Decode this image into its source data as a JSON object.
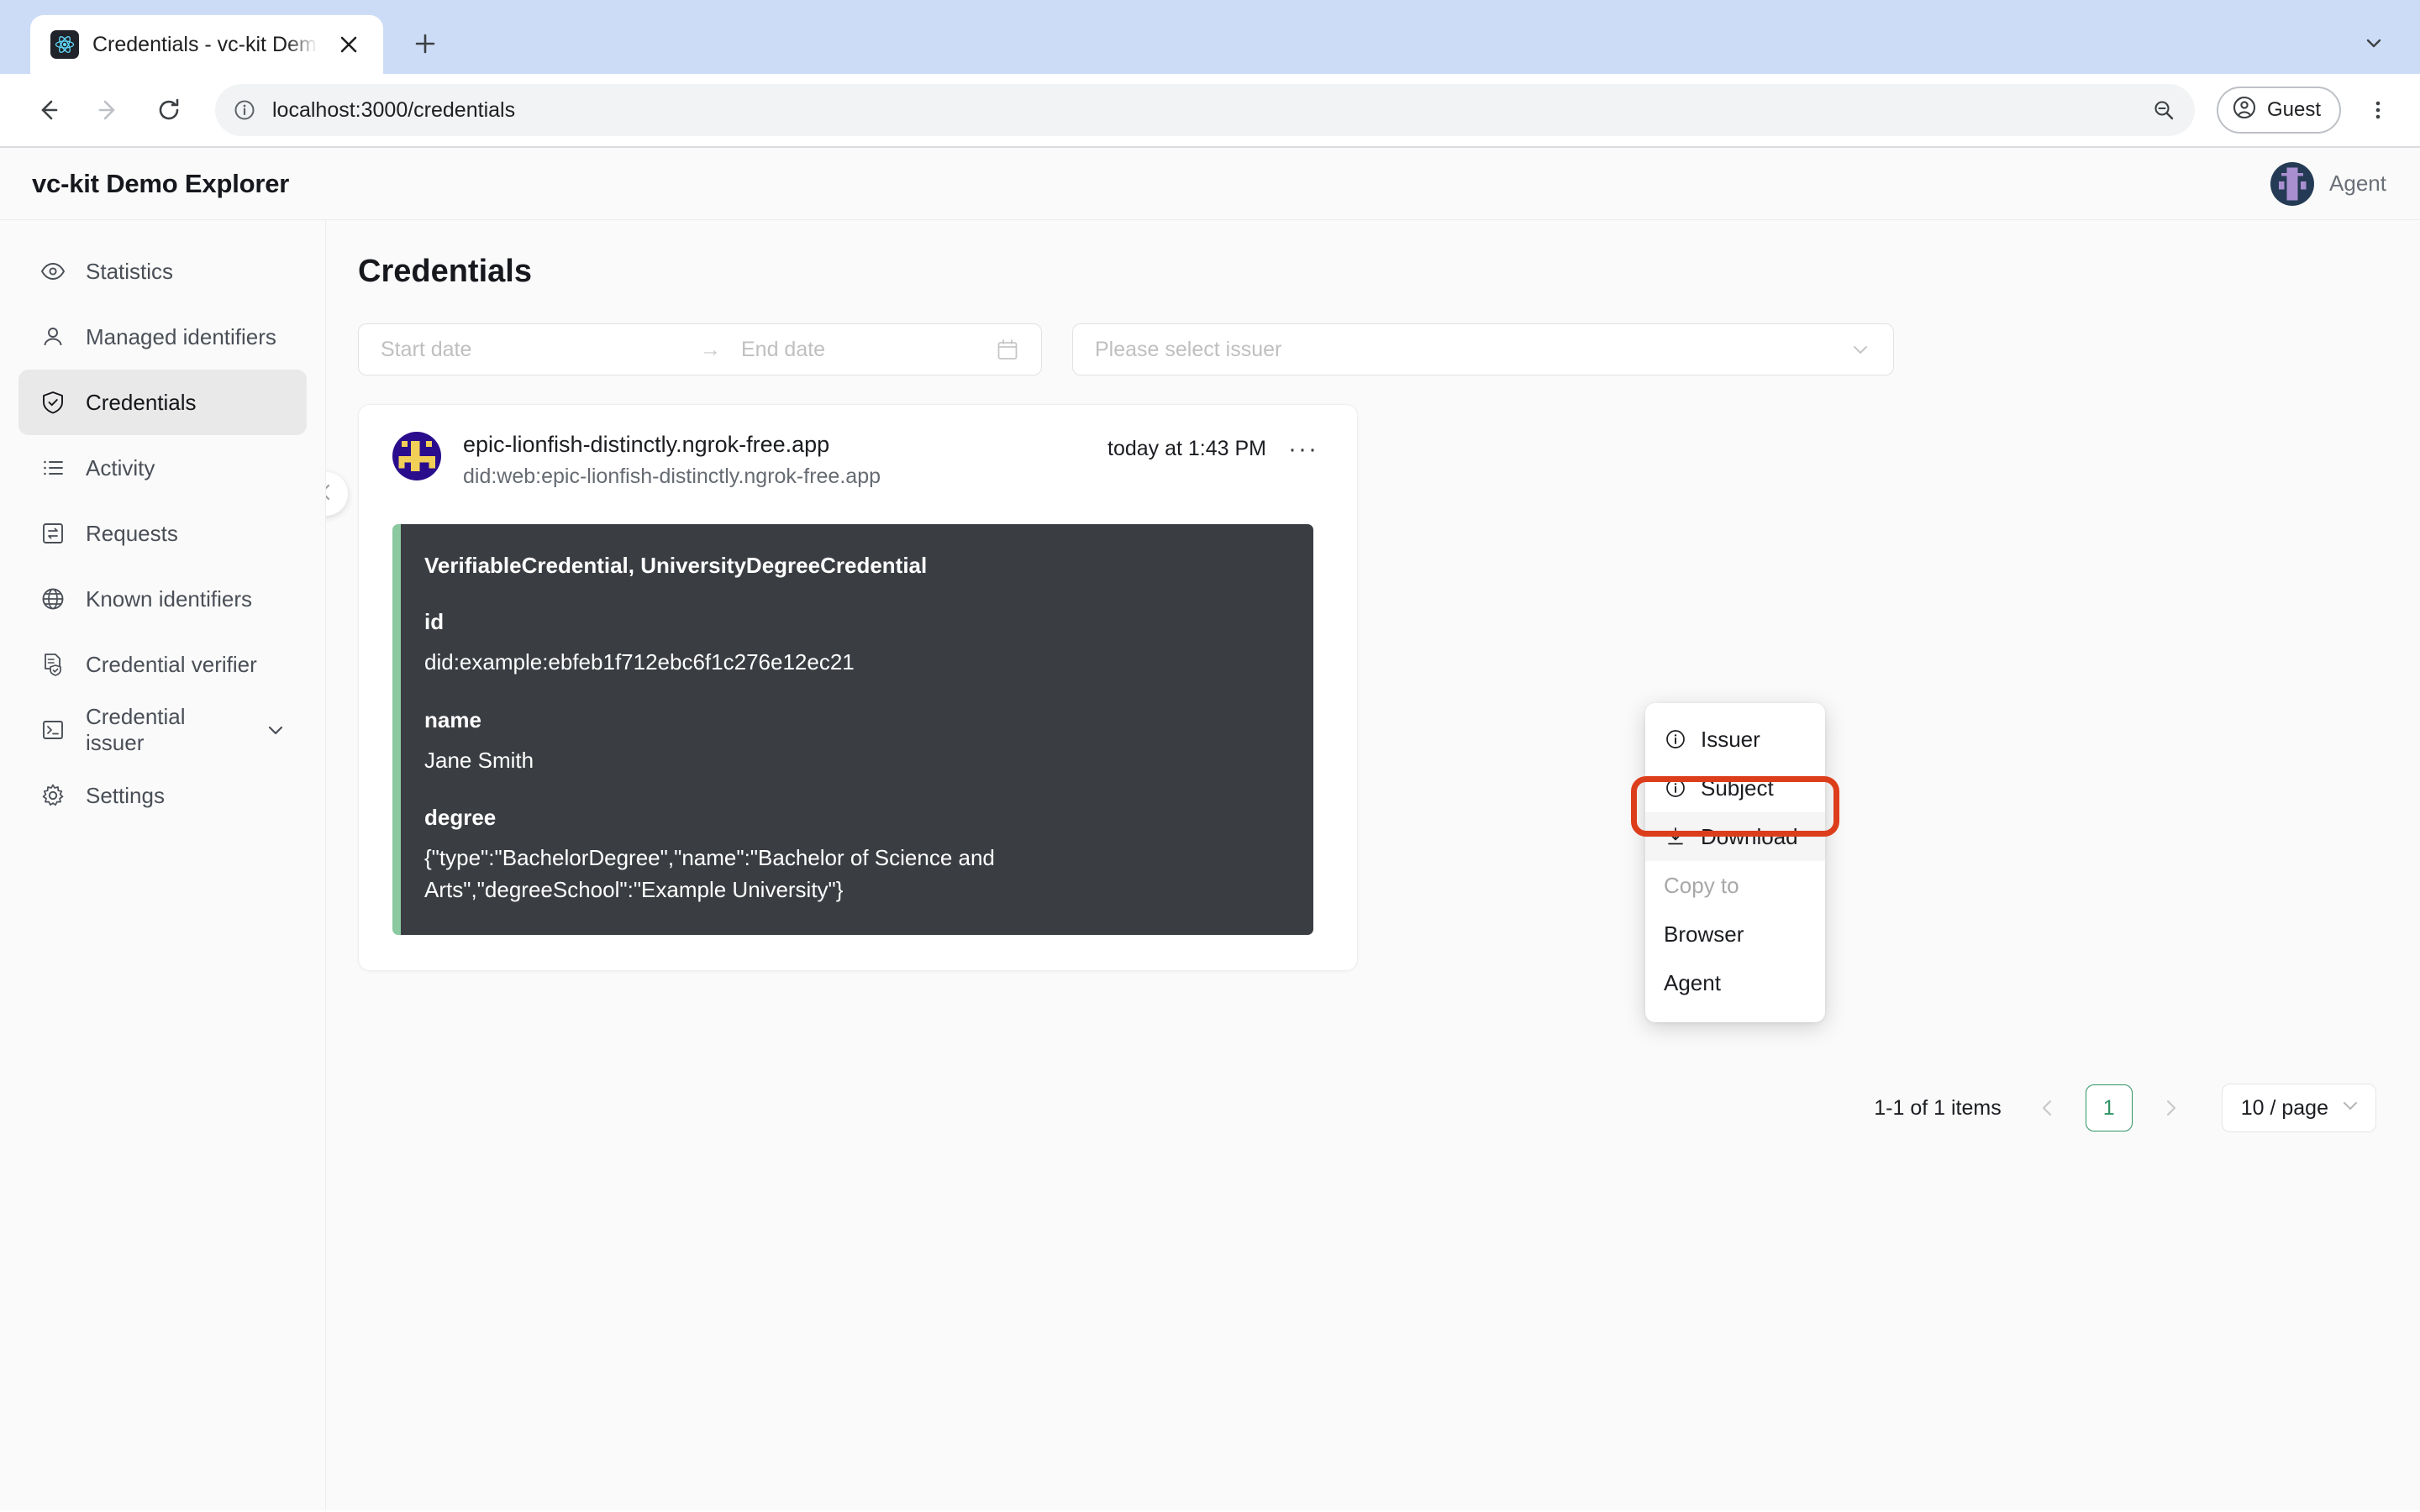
{
  "browser": {
    "tab": {
      "title": "Credentials - vc-kit Demo Ex",
      "favicon": "react-icon",
      "close": "close-icon"
    },
    "new_tab_label": "new-tab-icon",
    "back": "back-arrow-icon",
    "forward": "forward-arrow-icon",
    "reload": "reload-icon",
    "site_info": "info-icon",
    "url": "localhost:3000/credentials",
    "zoom_icon": "zoom-out-icon",
    "profile_label": "Guest",
    "menu_icon": "vertical-dots-icon"
  },
  "app": {
    "title": "vc-kit Demo Explorer",
    "user": {
      "name": "Agent",
      "avatar": "robot-avatar"
    }
  },
  "sidebar": {
    "items": [
      {
        "label": "Statistics",
        "icon": "eye-icon",
        "active": false,
        "expandable": false
      },
      {
        "label": "Managed identifiers",
        "icon": "user-icon",
        "active": false,
        "expandable": false
      },
      {
        "label": "Credentials",
        "icon": "shield-check-icon",
        "active": true,
        "expandable": false
      },
      {
        "label": "Activity",
        "icon": "list-icon",
        "active": false,
        "expandable": false
      },
      {
        "label": "Requests",
        "icon": "exchange-icon",
        "active": false,
        "expandable": false
      },
      {
        "label": "Known identifiers",
        "icon": "globe-icon",
        "active": false,
        "expandable": false
      },
      {
        "label": "Credential verifier",
        "icon": "document-shield-icon",
        "active": false,
        "expandable": false
      },
      {
        "label": "Credential issuer",
        "icon": "terminal-icon",
        "active": false,
        "expandable": true
      },
      {
        "label": "Settings",
        "icon": "gear-icon",
        "active": false,
        "expandable": false
      }
    ]
  },
  "page": {
    "heading": "Credentials",
    "collapse_icon": "chevron-left-icon"
  },
  "filters": {
    "start_date_placeholder": "Start date",
    "range_separator": "→",
    "end_date_placeholder": "End date",
    "calendar_icon": "calendar-icon",
    "issuer_placeholder": "Please select issuer",
    "issuer_chevron": "chevron-down-icon"
  },
  "credential": {
    "issuer_name": "epic-lionfish-distinctly.ngrok-free.app",
    "issuer_did": "did:web:epic-lionfish-distinctly.ngrok-free.app",
    "timestamp": "today at 1:43 PM",
    "more_icon": "ellipsis-icon",
    "accent_color": "#8BC9A0",
    "code": {
      "types": "VerifiableCredential, UniversityDegreeCredential",
      "fields": [
        {
          "key": "id",
          "value": "did:example:ebfeb1f712ebc6f1c276e12ec21"
        },
        {
          "key": "name",
          "value": "Jane Smith"
        },
        {
          "key": "degree",
          "value": "{\"type\":\"BachelorDegree\",\"name\":\"Bachelor of Science and Arts\",\"degreeSchool\":\"Example University\"}"
        }
      ]
    }
  },
  "context_menu": {
    "items": [
      {
        "label": "Issuer",
        "icon": "info-circle-icon",
        "highlighted": false,
        "muted": false,
        "indent": false
      },
      {
        "label": "Subject",
        "icon": "info-circle-icon",
        "highlighted": false,
        "muted": false,
        "indent": false
      },
      {
        "label": "Download",
        "icon": "download-icon",
        "highlighted": true,
        "muted": false,
        "indent": false
      },
      {
        "label": "Copy to",
        "icon": "",
        "highlighted": false,
        "muted": true,
        "indent": false
      },
      {
        "label": "Browser",
        "icon": "",
        "highlighted": false,
        "muted": false,
        "indent": true
      },
      {
        "label": "Agent",
        "icon": "",
        "highlighted": false,
        "muted": false,
        "indent": true
      }
    ],
    "highlight_color": "#DC3E1C"
  },
  "pagination": {
    "total_text": "1-1 of 1 items",
    "prev_icon": "chevron-left-icon",
    "current_page": "1",
    "next_icon": "chevron-right-icon",
    "page_size": "10 / page",
    "page_size_chevron": "chevron-down-icon",
    "accent_color": "#2E9465"
  }
}
